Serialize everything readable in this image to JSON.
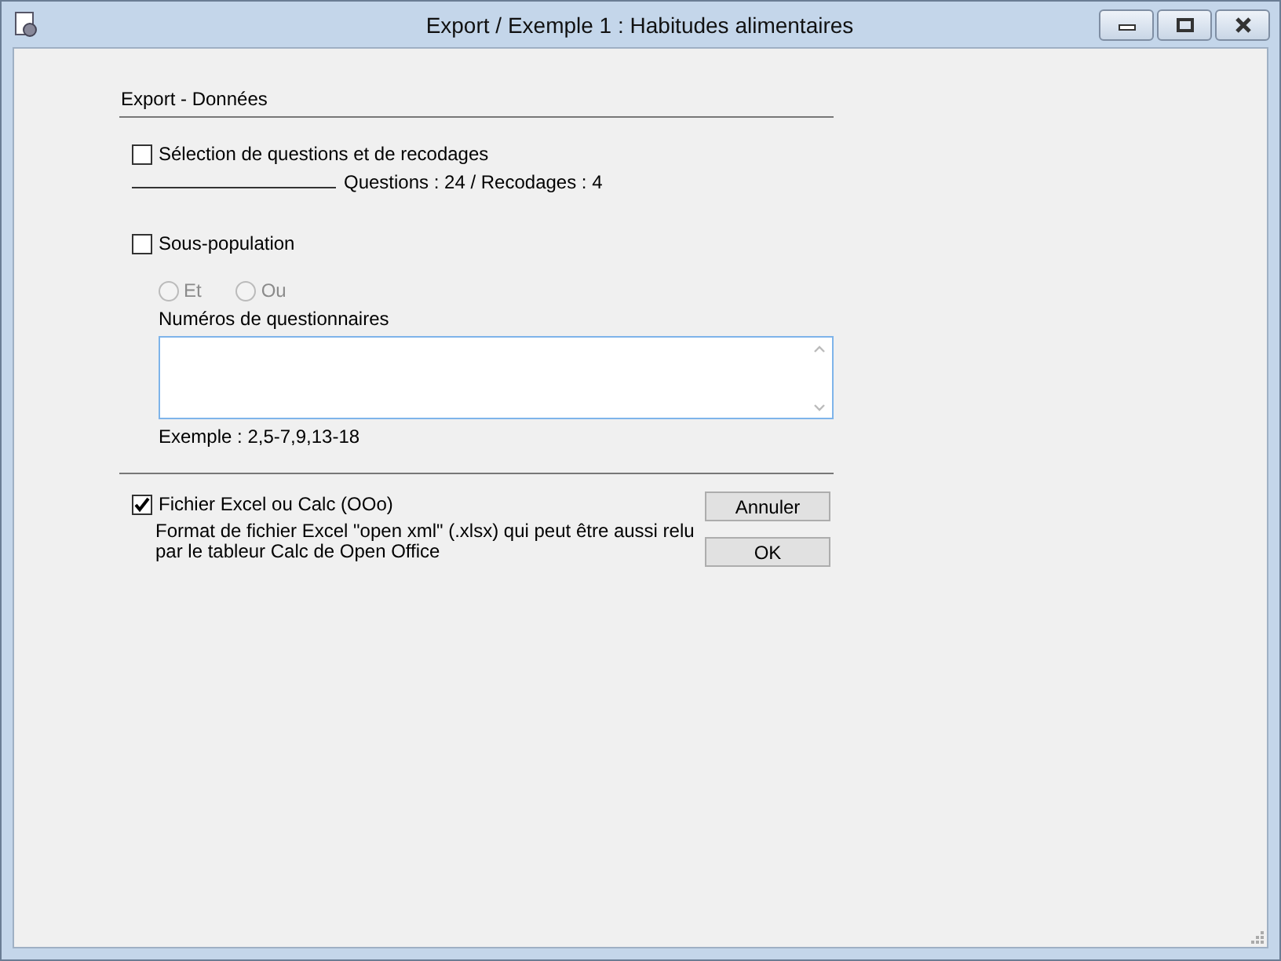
{
  "window": {
    "title": "Export / Exemple 1 : Habitudes alimentaires"
  },
  "section": {
    "title": "Export - Données"
  },
  "selection": {
    "label": "Sélection de questions et de recodages",
    "checked": false,
    "summary": "Questions : 24 / Recodages : 4"
  },
  "subpopulation": {
    "label": "Sous-population",
    "checked": false,
    "radios": [
      {
        "label": "Et",
        "selected": false,
        "disabled": true
      },
      {
        "label": "Ou",
        "selected": false,
        "disabled": true
      }
    ],
    "field_label": "Numéros de questionnaires",
    "example": "Exemple : 2,5-7,9,13-18"
  },
  "excel": {
    "label": "Fichier Excel ou Calc (OOo)",
    "checked": true,
    "description": "Format de fichier Excel \"open xml\" (.xlsx) qui peut être aussi relu par le tableur Calc de Open Office"
  },
  "buttons": [
    "Annuler",
    "OK"
  ]
}
